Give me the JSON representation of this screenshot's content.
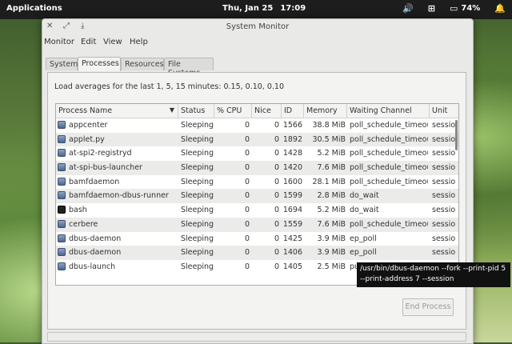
{
  "panel": {
    "applications": "Applications",
    "date": "Thu, Jan 25",
    "time": "17:09",
    "battery": "74%",
    "icons": [
      "volume-icon",
      "network-icon",
      "battery-icon",
      "notifications-icon"
    ]
  },
  "window": {
    "title": "System Monitor",
    "menu": [
      "Monitor",
      "Edit",
      "View",
      "Help"
    ]
  },
  "tabs": [
    "System",
    "Processes",
    "Resources",
    "File Systems"
  ],
  "active_tab": "Processes",
  "load_text": "Load averages for the last 1, 5, 15 minutes: 0.15, 0.10, 0.10",
  "columns": [
    "Process Name",
    "Status",
    "% CPU",
    "Nice",
    "ID",
    "Memory",
    "Waiting Channel",
    "Unit"
  ],
  "sort_indicator": "▼",
  "rows": [
    {
      "name": "appcenter",
      "status": "Sleeping",
      "cpu": "0",
      "nice": "0",
      "id": "1566",
      "mem": "38.8 MiB",
      "wchan": "poll_schedule_timeout",
      "unit": "sessio",
      "icon": "app"
    },
    {
      "name": "applet.py",
      "status": "Sleeping",
      "cpu": "0",
      "nice": "0",
      "id": "1892",
      "mem": "30.5 MiB",
      "wchan": "poll_schedule_timeout",
      "unit": "sessio",
      "icon": "app"
    },
    {
      "name": "at-spi2-registryd",
      "status": "Sleeping",
      "cpu": "0",
      "nice": "0",
      "id": "1428",
      "mem": "5.2 MiB",
      "wchan": "poll_schedule_timeout",
      "unit": "sessio",
      "icon": "app"
    },
    {
      "name": "at-spi-bus-launcher",
      "status": "Sleeping",
      "cpu": "0",
      "nice": "0",
      "id": "1420",
      "mem": "7.6 MiB",
      "wchan": "poll_schedule_timeout",
      "unit": "sessio",
      "icon": "app"
    },
    {
      "name": "bamfdaemon",
      "status": "Sleeping",
      "cpu": "0",
      "nice": "0",
      "id": "1600",
      "mem": "28.1 MiB",
      "wchan": "poll_schedule_timeout",
      "unit": "sessio",
      "icon": "app"
    },
    {
      "name": "bamfdaemon-dbus-runner",
      "status": "Sleeping",
      "cpu": "0",
      "nice": "0",
      "id": "1599",
      "mem": "2.8 MiB",
      "wchan": "do_wait",
      "unit": "sessio",
      "icon": "app"
    },
    {
      "name": "bash",
      "status": "Sleeping",
      "cpu": "0",
      "nice": "0",
      "id": "1694",
      "mem": "5.2 MiB",
      "wchan": "do_wait",
      "unit": "sessio",
      "icon": "term"
    },
    {
      "name": "cerbere",
      "status": "Sleeping",
      "cpu": "0",
      "nice": "0",
      "id": "1559",
      "mem": "7.6 MiB",
      "wchan": "poll_schedule_timeout",
      "unit": "sessio",
      "icon": "app"
    },
    {
      "name": "dbus-daemon",
      "status": "Sleeping",
      "cpu": "0",
      "nice": "0",
      "id": "1425",
      "mem": "3.9 MiB",
      "wchan": "ep_poll",
      "unit": "sessio",
      "icon": "app"
    },
    {
      "name": "dbus-daemon",
      "status": "Sleeping",
      "cpu": "0",
      "nice": "0",
      "id": "1406",
      "mem": "3.9 MiB",
      "wchan": "ep_poll",
      "unit": "sessio",
      "icon": "app"
    },
    {
      "name": "dbus-launch",
      "status": "Sleeping",
      "cpu": "0",
      "nice": "0",
      "id": "1405",
      "mem": "2.5 MiB",
      "wchan": "pu",
      "unit": "",
      "icon": "app"
    }
  ],
  "end_process": "End Process",
  "tooltip": "/usr/bin/dbus-daemon --fork --print-pid 5 --print-address 7 --session"
}
